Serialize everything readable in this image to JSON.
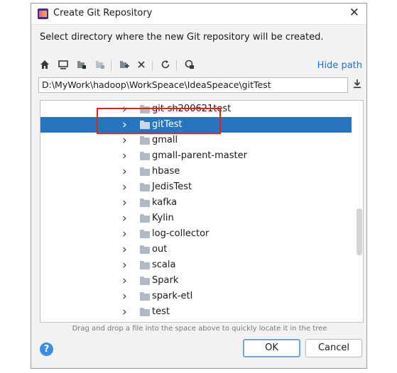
{
  "window": {
    "title": "Create Git Repository",
    "close_glyph": "✕"
  },
  "description": "Select directory where the new Git repository will be created.",
  "toolbar": {
    "icons": [
      "home-icon",
      "desktop-icon",
      "project-icon",
      "module-icon",
      "new-folder-icon",
      "delete-icon",
      "refresh-icon",
      "show-hidden-icon"
    ],
    "hide_path_label": "Hide path"
  },
  "path": {
    "value": "D:\\MyWork\\hadoop\\WorkSpeace\\IdeaSpeace\\gitTest"
  },
  "tree": {
    "items": [
      {
        "label": "git-sh200621test",
        "selected": false
      },
      {
        "label": "gitTest",
        "selected": true
      },
      {
        "label": "gmall",
        "selected": false
      },
      {
        "label": "gmall-parent-master",
        "selected": false
      },
      {
        "label": "hbase",
        "selected": false
      },
      {
        "label": "JedisTest",
        "selected": false
      },
      {
        "label": "kafka",
        "selected": false
      },
      {
        "label": "Kylin",
        "selected": false
      },
      {
        "label": "log-collector",
        "selected": false
      },
      {
        "label": "out",
        "selected": false
      },
      {
        "label": "scala",
        "selected": false
      },
      {
        "label": "Spark",
        "selected": false
      },
      {
        "label": "spark-etl",
        "selected": false
      },
      {
        "label": "test",
        "selected": false
      }
    ]
  },
  "hint": "Drag and drop a file into the space above to quickly locate it in the tree",
  "buttons": {
    "help": "?",
    "ok": "OK",
    "cancel": "Cancel"
  },
  "colors": {
    "selection": "#2675bf",
    "link": "#2470d8",
    "highlight_box": "#e0231f"
  }
}
